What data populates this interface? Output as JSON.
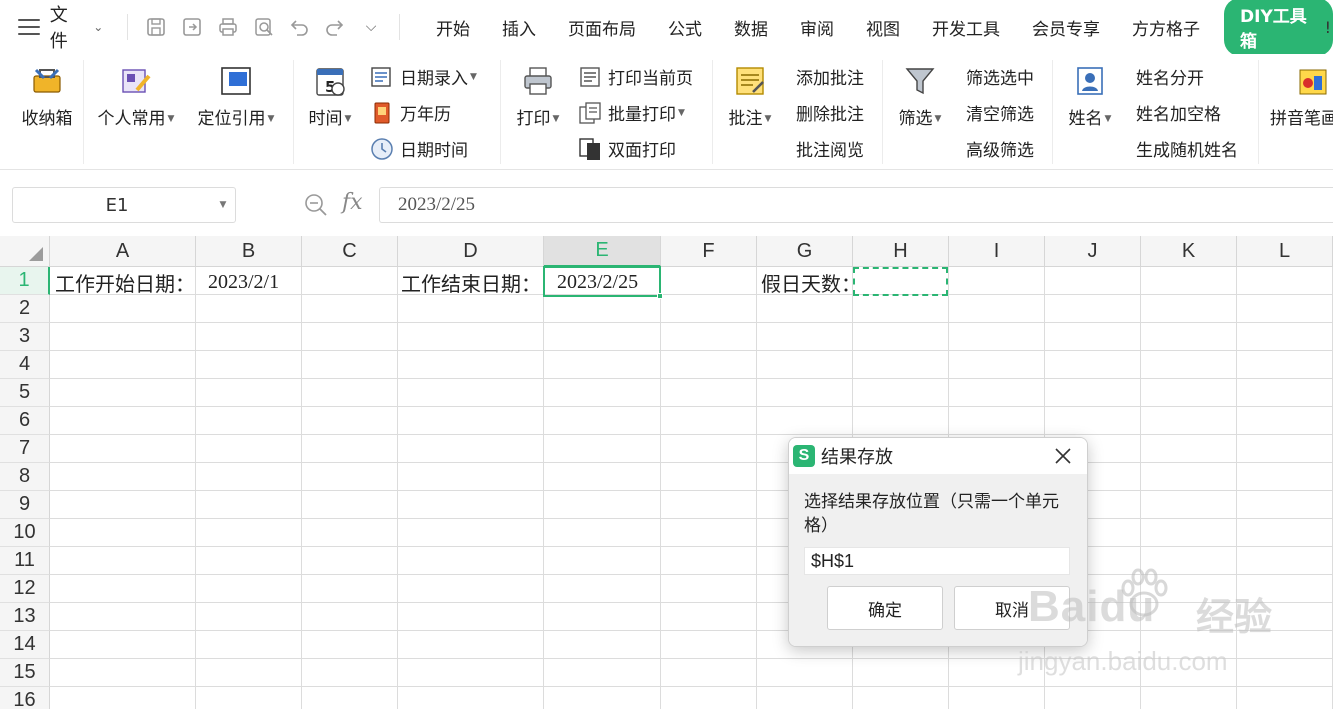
{
  "menubar": {
    "file_label": "文件",
    "tabs": [
      "开始",
      "插入",
      "页面布局",
      "公式",
      "数据",
      "审阅",
      "视图",
      "开发工具",
      "会员专享",
      "方方格子"
    ],
    "active_tab": "DIY工具箱"
  },
  "ribbon": {
    "storage_box": "收纳箱",
    "personal_common": "个人常用",
    "locate_ref": "定位引用",
    "time": "时间",
    "date_entry": "日期录入",
    "calendar": "万年历",
    "date_time": "日期时间",
    "print": "打印",
    "print_current": "打印当前页",
    "batch_print": "批量打印",
    "duplex_print": "双面打印",
    "annotation": "批注",
    "add_annotation": "添加批注",
    "delete_annotation": "删除批注",
    "annotation_view": "批注阅览",
    "filter": "筛选",
    "filter_selected": "筛选选中",
    "clear_filter": "清空筛选",
    "advanced_filter": "高级筛选",
    "name": "姓名",
    "split_name": "姓名分开",
    "name_add_space": "姓名加空格",
    "random_name": "生成随机姓名",
    "pinyin": "拼音笔画"
  },
  "formula_bar": {
    "name_box": "E1",
    "fx": "fx",
    "formula": "2023/2/25"
  },
  "sheet": {
    "columns": [
      "A",
      "B",
      "C",
      "D",
      "E",
      "F",
      "G",
      "H",
      "I",
      "J",
      "K",
      "L"
    ],
    "rows": [
      "1",
      "2",
      "3",
      "4",
      "5",
      "6",
      "7",
      "8",
      "9",
      "10",
      "11",
      "12",
      "13",
      "14",
      "15",
      "16"
    ],
    "selected_column": "E",
    "selected_row": "1",
    "cells": {
      "A1": "工作开始日期：",
      "B1": "2023/2/1",
      "D1": "工作结束日期：",
      "E1": "2023/2/25",
      "G1": "假日天数："
    }
  },
  "dialog": {
    "title": "结果存放",
    "prompt": "选择结果存放位置（只需一个单元格）",
    "value": "$H$1",
    "ok": "确定",
    "cancel": "取消"
  },
  "watermark": {
    "brand": "Baidu",
    "cn": "经验",
    "url": "jingyan.baidu.com"
  },
  "colors": {
    "accent": "#2bb573",
    "grid": "#dcdcdc",
    "header_bg": "#f5f5f5"
  }
}
